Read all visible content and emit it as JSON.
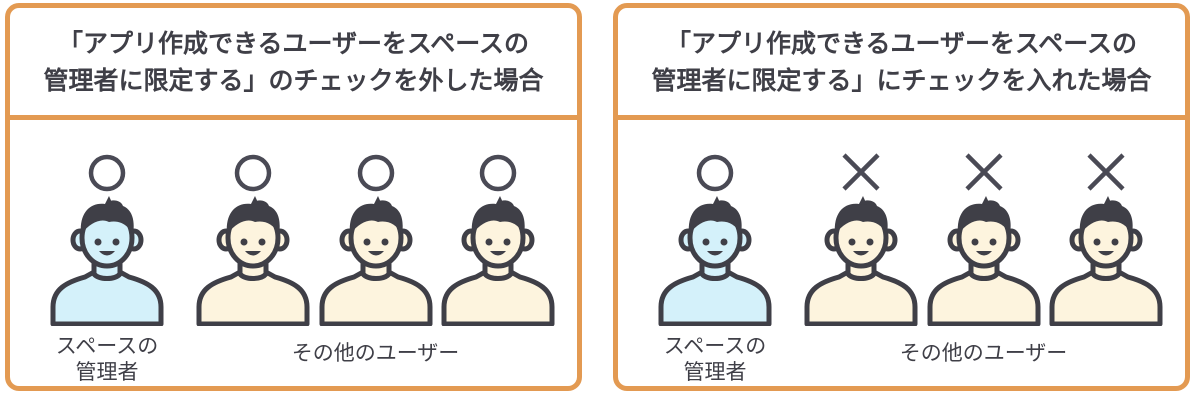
{
  "colors": {
    "border": "#e39a52",
    "ink": "#3f3f47",
    "admin_skin": "#d4f1fa",
    "user_skin": "#fdf4de",
    "mark": "#4a4a55"
  },
  "panels": [
    {
      "title_line1": "「アプリ作成できるユーザーをスペースの",
      "title_line2": "管理者に限定する」のチェックを外した場合",
      "admin_label_line1": "スペースの",
      "admin_label_line2": "管理者",
      "users_label": "その他のユーザー",
      "admin_mark": "circle",
      "user_marks": [
        "circle",
        "circle",
        "circle"
      ]
    },
    {
      "title_line1": "「アプリ作成できるユーザーをスペースの",
      "title_line2": "管理者に限定する」にチェックを入れた場合",
      "admin_label_line1": "スペースの",
      "admin_label_line2": "管理者",
      "users_label": "その他のユーザー",
      "admin_mark": "circle",
      "user_marks": [
        "cross",
        "cross",
        "cross"
      ]
    }
  ]
}
